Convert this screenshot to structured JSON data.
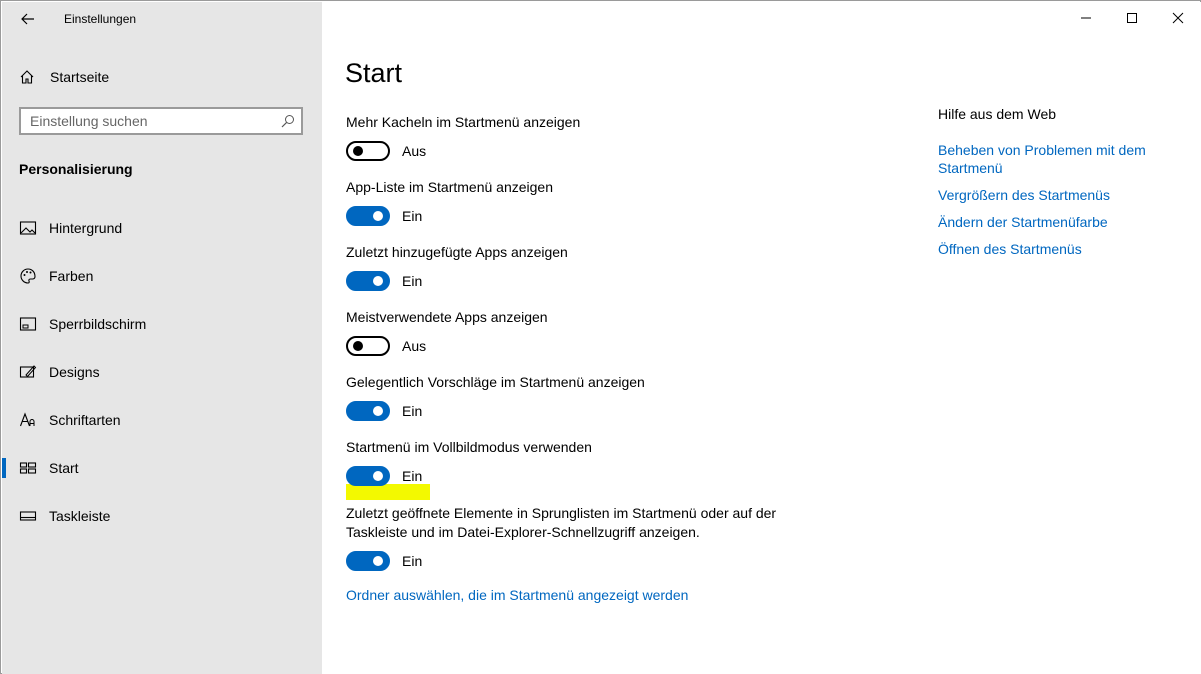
{
  "app": {
    "title": "Einstellungen"
  },
  "sidebar": {
    "home_label": "Startseite",
    "search_placeholder": "Einstellung suchen",
    "section_title": "Personalisierung",
    "items": [
      {
        "label": "Hintergrund",
        "icon": "image-icon"
      },
      {
        "label": "Farben",
        "icon": "palette-icon"
      },
      {
        "label": "Sperrbildschirm",
        "icon": "lock-screen-icon"
      },
      {
        "label": "Designs",
        "icon": "themes-icon"
      },
      {
        "label": "Schriftarten",
        "icon": "fonts-icon"
      },
      {
        "label": "Start",
        "icon": "start-icon",
        "active": true
      },
      {
        "label": "Taskleiste",
        "icon": "taskbar-icon"
      }
    ]
  },
  "main": {
    "title": "Start",
    "settings": [
      {
        "label": "Mehr Kacheln im Startmenü anzeigen",
        "state": "Aus",
        "on": false
      },
      {
        "label": "App-Liste im Startmenü anzeigen",
        "state": "Ein",
        "on": true
      },
      {
        "label": "Zuletzt hinzugefügte Apps anzeigen",
        "state": "Ein",
        "on": true
      },
      {
        "label": "Meistverwendete Apps anzeigen",
        "state": "Aus",
        "on": false
      },
      {
        "label": "Gelegentlich Vorschläge im Startmenü anzeigen",
        "state": "Ein",
        "on": true
      },
      {
        "label": "Startmenü im Vollbildmodus verwenden",
        "state": "Ein",
        "on": true
      },
      {
        "label": "Zuletzt geöffnete Elemente in Sprunglisten im Startmenü oder auf der Taskleiste und im Datei-Explorer-Schnellzugriff anzeigen.",
        "state": "Ein",
        "on": true
      }
    ],
    "folder_link": "Ordner auswählen, die im Startmenü angezeigt werden"
  },
  "help": {
    "title": "Hilfe aus dem Web",
    "links": [
      "Beheben von Problemen mit dem Startmenü",
      "Vergrößern des Startmenüs",
      "Ändern der Startmenüfarbe",
      "Öffnen des Startmenüs"
    ]
  },
  "colors": {
    "accent": "#0067c0",
    "sidebar_bg": "#e6e6e6",
    "highlight": "#f3f900"
  }
}
